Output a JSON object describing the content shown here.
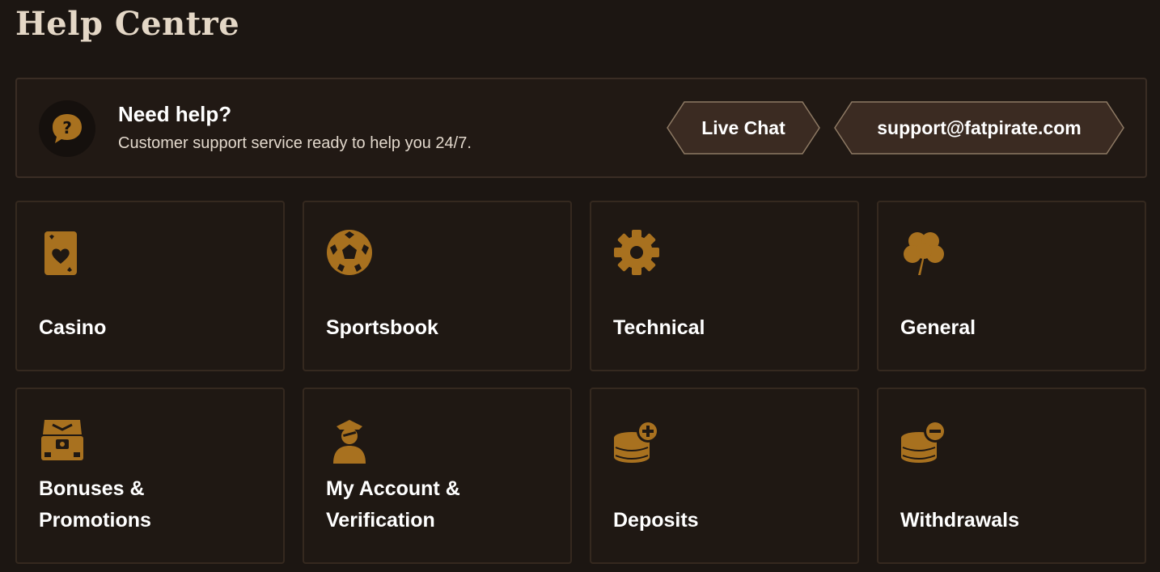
{
  "page": {
    "title": "Help Centre"
  },
  "help_banner": {
    "icon": "question-bubble-icon",
    "heading": "Need help?",
    "subtext": "Customer support service ready to help you 24/7.",
    "live_chat_label": "Live Chat",
    "email_label": "support@fatpirate.com"
  },
  "categories": [
    {
      "label": "Casino",
      "icon": "playing-card-heart-icon"
    },
    {
      "label": "Sportsbook",
      "icon": "soccer-ball-icon"
    },
    {
      "label": "Technical",
      "icon": "gear-icon"
    },
    {
      "label": "General",
      "icon": "clover-icon"
    },
    {
      "label": "Bonuses & Promotions",
      "icon": "treasure-chest-icon"
    },
    {
      "label": "My Account & Verification",
      "icon": "pirate-user-icon"
    },
    {
      "label": "Deposits",
      "icon": "coin-stack-plus-icon"
    },
    {
      "label": "Withdrawals",
      "icon": "coin-stack-minus-icon"
    }
  ],
  "colors": {
    "background": "#1c1612",
    "panel": "#211914",
    "accent": "#b07a2a",
    "button": "#3b2b22",
    "title": "#e4d7c6"
  }
}
